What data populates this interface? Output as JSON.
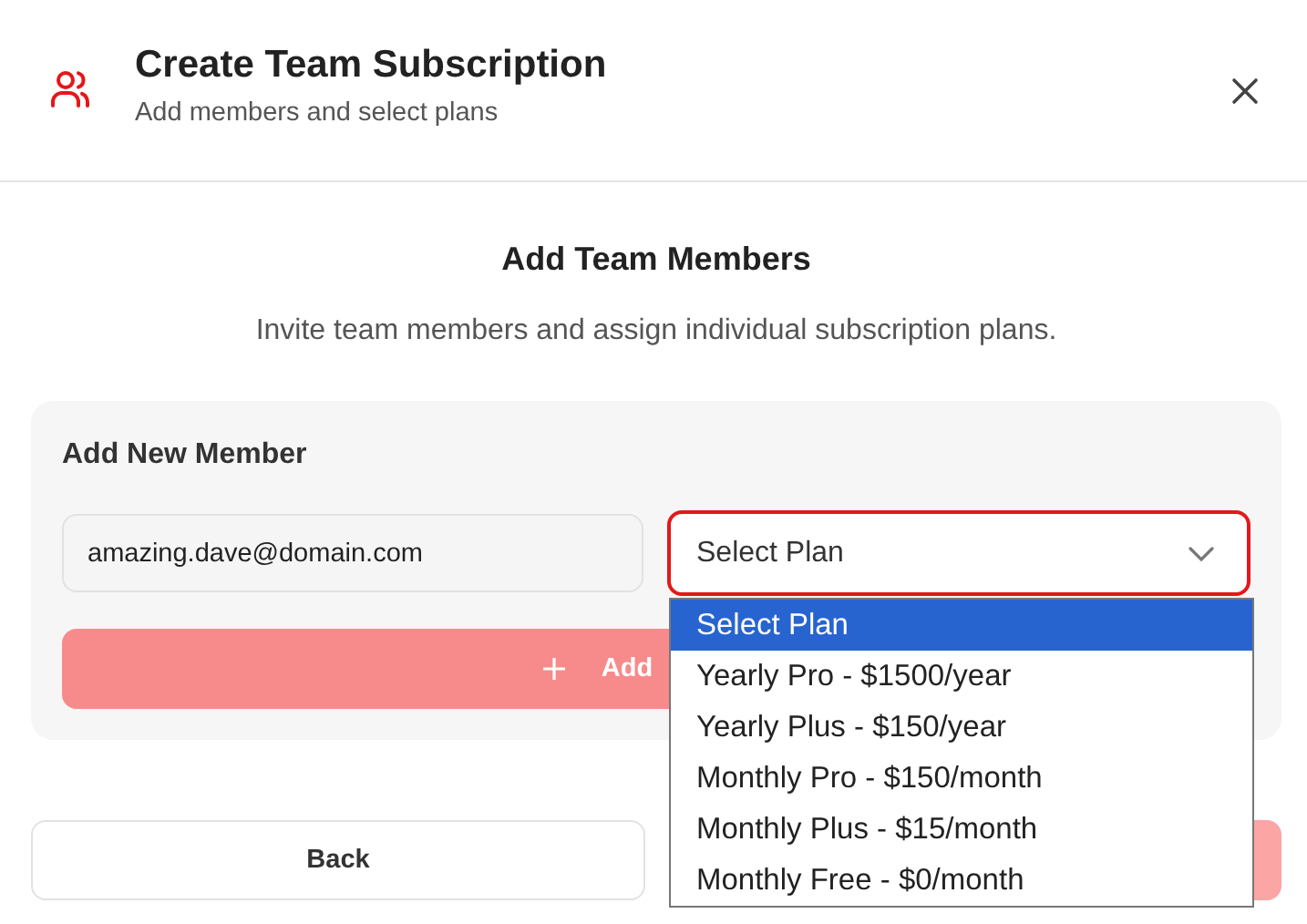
{
  "dialog": {
    "title": "Create Team Subscription",
    "subtitle": "Add members and select plans"
  },
  "section": {
    "heading": "Add Team Members",
    "description": "Invite team members and assign individual subscription plans."
  },
  "member_form": {
    "title": "Add New Member",
    "email": {
      "value": "amazing.dave@domain.com"
    },
    "plan_select": {
      "value": "Select Plan",
      "expanded": true
    },
    "add_button": {
      "label": "Add"
    }
  },
  "plan_options": [
    {
      "label": "Select Plan",
      "selected": true
    },
    {
      "label": "Yearly Pro - $1500/year",
      "selected": false
    },
    {
      "label": "Yearly Plus - $150/year",
      "selected": false
    },
    {
      "label": "Monthly Pro - $150/month",
      "selected": false
    },
    {
      "label": "Monthly Plus - $15/month",
      "selected": false
    },
    {
      "label": "Monthly Free - $0/month",
      "selected": false
    }
  ],
  "footer": {
    "back_button": "Back"
  }
}
